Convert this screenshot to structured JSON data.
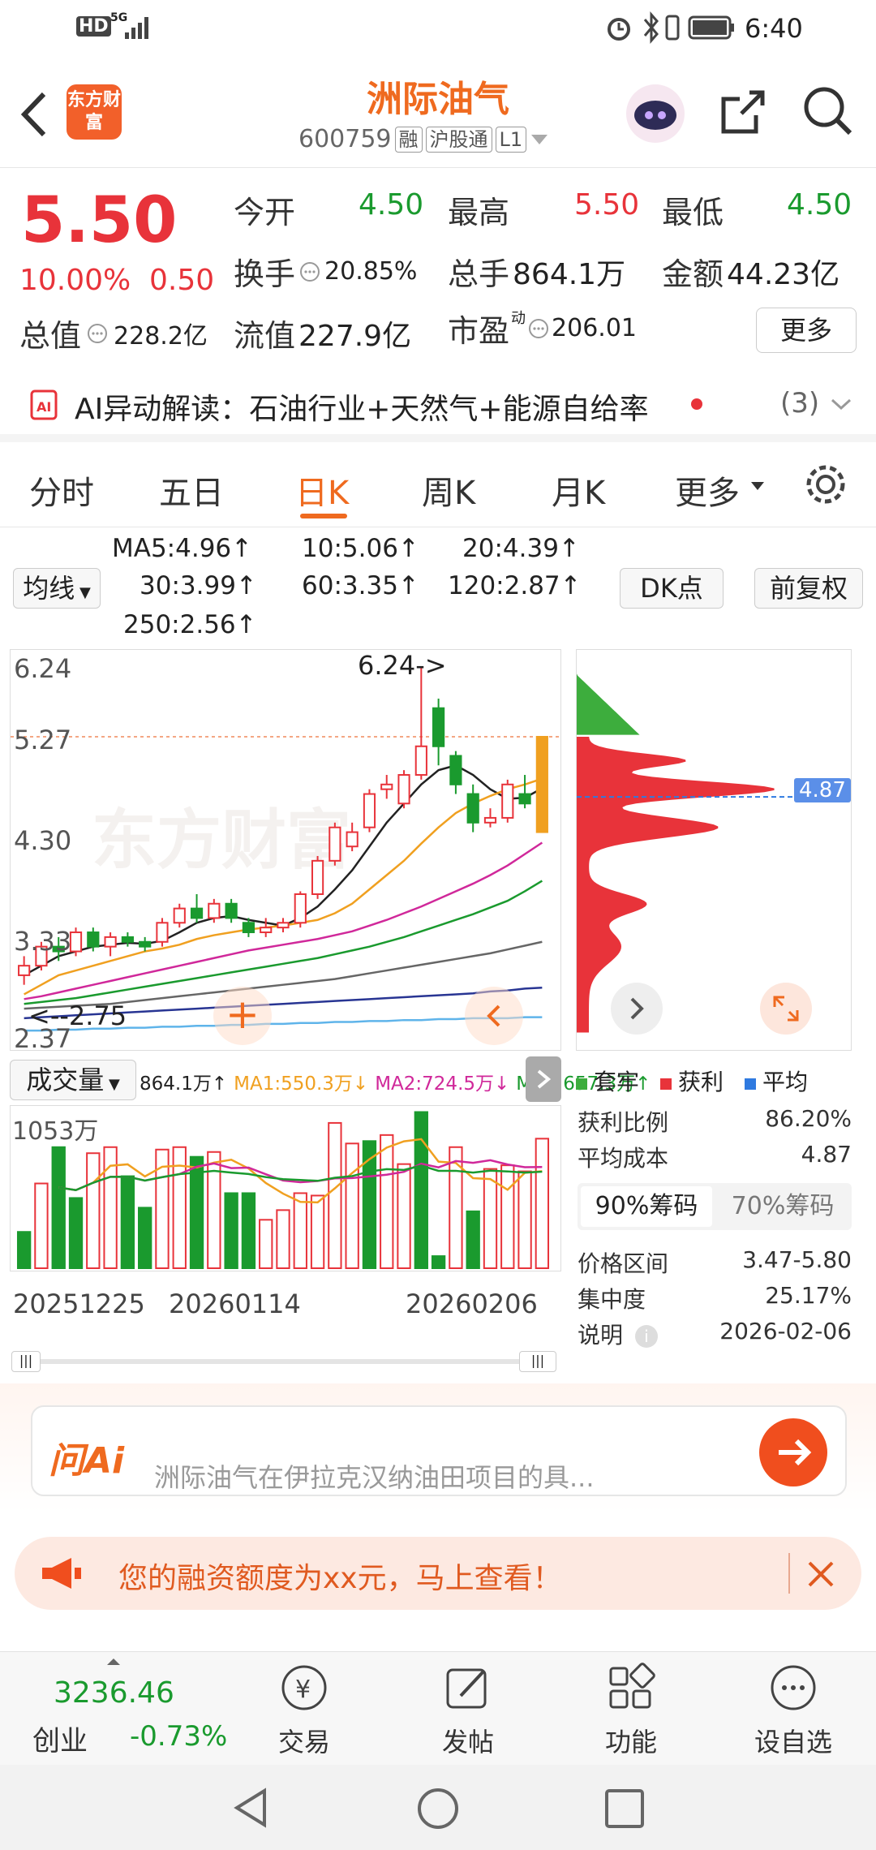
{
  "status_bar": {
    "network": "HD",
    "signal_label": "5G",
    "time": "6:40"
  },
  "header": {
    "logo_text": "东方财富",
    "stock_name": "洲际油气",
    "stock_code": "600759",
    "tags": [
      "融",
      "沪股通",
      "L1"
    ]
  },
  "quote": {
    "price": "5.50",
    "change_pct": "10.00%",
    "change_abs": "0.50",
    "total_value_label": "总值",
    "total_value": "228.2亿",
    "fields": [
      {
        "label": "今开",
        "value": "4.50"
      },
      {
        "label": "最高",
        "value": "5.50"
      },
      {
        "label": "最低",
        "value": "4.50"
      },
      {
        "label": "换手",
        "value": "20.85%"
      },
      {
        "label": "总手",
        "value": "864.1万"
      },
      {
        "label": "金额",
        "value": "44.23亿"
      },
      {
        "label": "流值",
        "value": "227.9亿"
      },
      {
        "label": "市盈",
        "value": "206.01",
        "superscript": "动"
      }
    ],
    "more_label": "更多"
  },
  "ai_strip": {
    "text": "AI异动解读：石油行业+天然气+能源自给率",
    "count": "(3)"
  },
  "tabs": [
    {
      "label": "分时"
    },
    {
      "label": "五日"
    },
    {
      "label": "日K"
    },
    {
      "label": "周K"
    },
    {
      "label": "月K"
    },
    {
      "label": "更多"
    }
  ],
  "ma_indicators": {
    "selector_label": "均线",
    "items": [
      {
        "text": "MA5:4.96↑",
        "color": "#222222"
      },
      {
        "text": "10:5.06↑",
        "color": "#f0a020"
      },
      {
        "text": "20:4.39↑",
        "color": "#d0289a"
      },
      {
        "text": "30:3.99↑",
        "color": "#1a9a2e"
      },
      {
        "text": "60:3.35↑",
        "color": "#666666"
      },
      {
        "text": "120:2.87↑",
        "color": "#283593"
      },
      {
        "text": "250:2.56↑",
        "color": "#5fb4ea"
      }
    ],
    "dk_label": "DK点",
    "adjust_label": "前复权"
  },
  "kchart": {
    "y_ticks": [
      "6.24",
      "5.27",
      "4.30",
      "3.33",
      "2.37"
    ],
    "high_marker": "6.24->",
    "low_marker": "<--2.75",
    "watermark": "东方财富"
  },
  "chart_data": {
    "type": "candlestick",
    "ylim": [
      2.37,
      6.24
    ],
    "candles": [
      {
        "o": 3.0,
        "c": 3.1,
        "h": 3.2,
        "l": 2.9
      },
      {
        "o": 3.1,
        "c": 3.3,
        "h": 3.35,
        "l": 3.05
      },
      {
        "o": 3.3,
        "c": 3.25,
        "h": 3.4,
        "l": 3.15
      },
      {
        "o": 3.25,
        "c": 3.45,
        "h": 3.5,
        "l": 3.2
      },
      {
        "o": 3.45,
        "c": 3.3,
        "h": 3.5,
        "l": 3.25
      },
      {
        "o": 3.3,
        "c": 3.4,
        "h": 3.45,
        "l": 3.2
      },
      {
        "o": 3.4,
        "c": 3.35,
        "h": 3.45,
        "l": 3.3
      },
      {
        "o": 3.35,
        "c": 3.3,
        "h": 3.4,
        "l": 3.25
      },
      {
        "o": 3.35,
        "c": 3.55,
        "h": 3.6,
        "l": 3.3
      },
      {
        "o": 3.55,
        "c": 3.7,
        "h": 3.75,
        "l": 3.5
      },
      {
        "o": 3.7,
        "c": 3.6,
        "h": 3.85,
        "l": 3.55
      },
      {
        "o": 3.6,
        "c": 3.75,
        "h": 3.8,
        "l": 3.55
      },
      {
        "o": 3.75,
        "c": 3.6,
        "h": 3.8,
        "l": 3.55
      },
      {
        "o": 3.55,
        "c": 3.45,
        "h": 3.6,
        "l": 3.4
      },
      {
        "o": 3.45,
        "c": 3.5,
        "h": 3.6,
        "l": 3.4
      },
      {
        "o": 3.5,
        "c": 3.55,
        "h": 3.6,
        "l": 3.45
      },
      {
        "o": 3.55,
        "c": 3.85,
        "h": 3.88,
        "l": 3.5
      },
      {
        "o": 3.85,
        "c": 4.2,
        "h": 4.25,
        "l": 3.8
      },
      {
        "o": 4.2,
        "c": 4.55,
        "h": 4.6,
        "l": 4.15
      },
      {
        "o": 4.35,
        "c": 4.5,
        "h": 4.6,
        "l": 4.3
      },
      {
        "o": 4.55,
        "c": 4.9,
        "h": 4.95,
        "l": 4.5
      },
      {
        "o": 4.95,
        "c": 5.0,
        "h": 5.1,
        "l": 4.85
      },
      {
        "o": 4.8,
        "c": 5.1,
        "h": 5.15,
        "l": 4.75
      },
      {
        "o": 5.1,
        "c": 5.4,
        "h": 6.24,
        "l": 5.05
      },
      {
        "o": 5.8,
        "c": 5.4,
        "h": 5.9,
        "l": 5.2
      },
      {
        "o": 5.3,
        "c": 5.0,
        "h": 5.35,
        "l": 4.9
      },
      {
        "o": 4.9,
        "c": 4.6,
        "h": 5.0,
        "l": 4.5
      },
      {
        "o": 4.6,
        "c": 4.65,
        "h": 4.75,
        "l": 4.55
      },
      {
        "o": 4.65,
        "c": 5.0,
        "h": 5.05,
        "l": 4.6
      },
      {
        "o": 4.9,
        "c": 4.8,
        "h": 5.1,
        "l": 4.75
      },
      {
        "o": 4.5,
        "c": 5.5,
        "h": 5.5,
        "l": 4.5
      }
    ],
    "ma_series": [
      {
        "name": "MA5",
        "color": "#222222",
        "values": [
          3.0,
          3.1,
          3.2,
          3.25,
          3.3,
          3.32,
          3.34,
          3.33,
          3.36,
          3.45,
          3.55,
          3.6,
          3.62,
          3.58,
          3.55,
          3.52,
          3.6,
          3.72,
          3.9,
          4.1,
          4.35,
          4.6,
          4.8,
          5.0,
          5.15,
          5.2,
          5.1,
          4.95,
          4.85,
          4.86,
          4.96
        ]
      },
      {
        "name": "MA10",
        "color": "#f0a020",
        "values": [
          2.8,
          2.9,
          3.0,
          3.05,
          3.1,
          3.15,
          3.2,
          3.25,
          3.28,
          3.32,
          3.38,
          3.42,
          3.45,
          3.48,
          3.5,
          3.52,
          3.55,
          3.58,
          3.65,
          3.75,
          3.9,
          4.05,
          4.2,
          4.38,
          4.55,
          4.7,
          4.8,
          4.88,
          4.95,
          5.0,
          5.06
        ]
      },
      {
        "name": "MA20",
        "color": "#d0289a",
        "values": [
          2.75,
          2.78,
          2.82,
          2.86,
          2.9,
          2.94,
          2.98,
          3.02,
          3.06,
          3.1,
          3.14,
          3.18,
          3.22,
          3.26,
          3.29,
          3.32,
          3.35,
          3.38,
          3.42,
          3.46,
          3.52,
          3.58,
          3.65,
          3.72,
          3.8,
          3.88,
          3.96,
          4.05,
          4.15,
          4.27,
          4.39
        ]
      },
      {
        "name": "MA30",
        "color": "#1a9a2e",
        "values": [
          2.7,
          2.72,
          2.74,
          2.76,
          2.79,
          2.82,
          2.85,
          2.88,
          2.91,
          2.94,
          2.97,
          3.0,
          3.03,
          3.06,
          3.09,
          3.12,
          3.15,
          3.18,
          3.22,
          3.26,
          3.3,
          3.35,
          3.4,
          3.46,
          3.52,
          3.58,
          3.64,
          3.71,
          3.78,
          3.88,
          3.99
        ]
      },
      {
        "name": "MA60",
        "color": "#666666",
        "values": [
          2.65,
          2.66,
          2.67,
          2.68,
          2.69,
          2.7,
          2.72,
          2.74,
          2.76,
          2.78,
          2.8,
          2.82,
          2.84,
          2.86,
          2.88,
          2.9,
          2.92,
          2.94,
          2.96,
          2.99,
          3.02,
          3.05,
          3.08,
          3.11,
          3.14,
          3.17,
          3.2,
          3.23,
          3.27,
          3.31,
          3.35
        ]
      },
      {
        "name": "MA120",
        "color": "#283593",
        "values": [
          2.55,
          2.56,
          2.57,
          2.58,
          2.59,
          2.6,
          2.61,
          2.62,
          2.63,
          2.64,
          2.65,
          2.66,
          2.67,
          2.68,
          2.69,
          2.7,
          2.71,
          2.72,
          2.73,
          2.74,
          2.75,
          2.76,
          2.77,
          2.78,
          2.79,
          2.8,
          2.81,
          2.83,
          2.84,
          2.86,
          2.87
        ]
      },
      {
        "name": "MA250",
        "color": "#5fb4ea",
        "values": [
          2.42,
          2.42,
          2.43,
          2.43,
          2.44,
          2.44,
          2.45,
          2.45,
          2.46,
          2.46,
          2.47,
          2.47,
          2.48,
          2.48,
          2.49,
          2.49,
          2.5,
          2.5,
          2.51,
          2.51,
          2.52,
          2.52,
          2.53,
          2.53,
          2.54,
          2.54,
          2.55,
          2.55,
          2.55,
          2.56,
          2.56
        ]
      }
    ],
    "volume": [
      {
        "v": 300,
        "up": false
      },
      {
        "v": 700,
        "up": true
      },
      {
        "v": 1000,
        "up": false
      },
      {
        "v": 580,
        "up": false
      },
      {
        "v": 950,
        "up": true
      },
      {
        "v": 1000,
        "up": true
      },
      {
        "v": 760,
        "up": false
      },
      {
        "v": 500,
        "up": false
      },
      {
        "v": 980,
        "up": true
      },
      {
        "v": 1000,
        "up": true
      },
      {
        "v": 920,
        "up": false
      },
      {
        "v": 960,
        "up": true
      },
      {
        "v": 620,
        "up": false
      },
      {
        "v": 620,
        "up": false
      },
      {
        "v": 400,
        "up": true
      },
      {
        "v": 480,
        "up": true
      },
      {
        "v": 620,
        "up": true
      },
      {
        "v": 600,
        "up": true
      },
      {
        "v": 1200,
        "up": true
      },
      {
        "v": 1030,
        "up": true
      },
      {
        "v": 1050,
        "up": false
      },
      {
        "v": 1100,
        "up": true
      },
      {
        "v": 860,
        "up": true
      },
      {
        "v": 1290,
        "up": false
      },
      {
        "v": 100,
        "up": false
      },
      {
        "v": 1000,
        "up": true
      },
      {
        "v": 470,
        "up": false
      },
      {
        "v": 820,
        "up": true
      },
      {
        "v": 850,
        "up": true
      },
      {
        "v": 800,
        "up": true
      },
      {
        "v": 1070,
        "up": true
      }
    ],
    "volume_ylim": [
      0,
      1300
    ],
    "volume_max_label": "1053万",
    "dates": [
      "20251225",
      "20260114",
      "20260206"
    ]
  },
  "volume_indicator": {
    "selector_label": "成交量",
    "items": [
      {
        "text": "864.1万↑",
        "color": "#222222"
      },
      {
        "text": "MA1:550.3万↓",
        "color": "#f0a020"
      },
      {
        "text": "MA2:724.5万↓",
        "color": "#d0289a"
      },
      {
        "text": "MA3:657.3万↑",
        "color": "#1a9a2e"
      }
    ]
  },
  "chips": {
    "avg_cost_tag": "4.87",
    "legend": [
      {
        "label": "套牢",
        "color": "#3dad3d"
      },
      {
        "label": "获利",
        "color": "#e8333a"
      },
      {
        "label": "平均",
        "color": "#2f7ae0"
      }
    ],
    "rows": [
      {
        "label": "获利比例",
        "value": "86.20%"
      },
      {
        "label": "平均成本",
        "value": "4.87"
      }
    ],
    "chip_tabs": [
      "90%筹码",
      "70%筹码"
    ],
    "rows2": [
      {
        "label": "价格区间",
        "value": "3.47-5.80"
      },
      {
        "label": "集中度",
        "value": "25.17%"
      },
      {
        "label": "说明",
        "value": "2026-02-06"
      }
    ]
  },
  "ask_ai": {
    "brand": "问Ai",
    "line1": "洲际油气在伊拉克汉纳油田项目的具..."
  },
  "promo": {
    "text": "您的融资额度为xx元，马上查看！"
  },
  "bottom_nav": {
    "index_value": "3236.46",
    "index_name": "创业",
    "index_change": "-0.73%",
    "items": [
      {
        "label": "交易"
      },
      {
        "label": "发帖"
      },
      {
        "label": "功能"
      },
      {
        "label": "设自选"
      }
    ]
  }
}
